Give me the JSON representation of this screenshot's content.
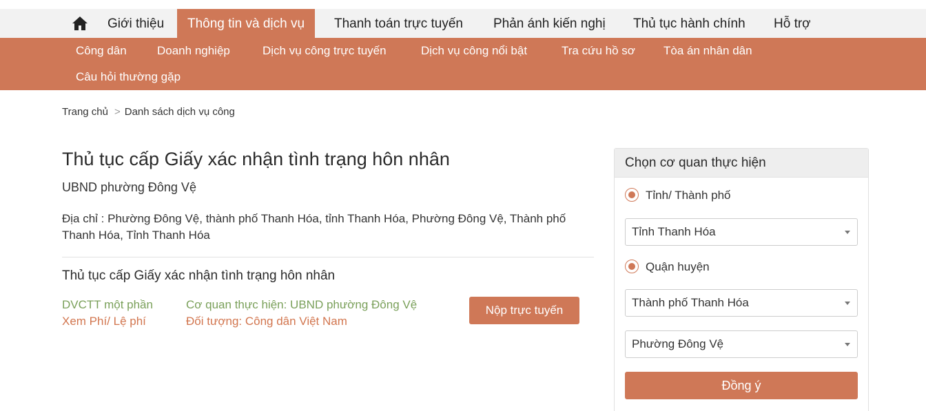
{
  "topnav": {
    "items": [
      {
        "label": "Giới thiệu"
      },
      {
        "label": "Thông tin và dịch vụ"
      },
      {
        "label": "Thanh toán trực tuyến"
      },
      {
        "label": "Phản ánh kiến nghị"
      },
      {
        "label": "Thủ tục hành chính"
      },
      {
        "label": "Hỗ trợ"
      }
    ],
    "home_icon": "home-icon"
  },
  "subnav": {
    "items": [
      {
        "label": "Công dân"
      },
      {
        "label": "Doanh nghiệp"
      },
      {
        "label": "Dịch vụ công trực tuyến"
      },
      {
        "label": "Dịch vụ công nổi bật"
      },
      {
        "label": "Tra cứu hồ sơ"
      },
      {
        "label": "Tòa án nhân dân"
      },
      {
        "label": "Câu hỏi thường gặp"
      }
    ]
  },
  "breadcrumb": {
    "home": "Trang chủ",
    "separator": ">",
    "current": "Danh sách dịch vụ công"
  },
  "main": {
    "title": "Thủ tục cấp Giấy xác nhận tình trạng hôn nhân",
    "agency": "UBND phường Đông Vệ",
    "address": "Địa chỉ : Phường Đông Vệ, thành phố Thanh Hóa, tỉnh Thanh Hóa, Phường Đông Vệ, Thành phố Thanh Hóa, Tỉnh Thanh Hóa",
    "procedure": {
      "title": "Thủ tục cấp Giấy xác nhận tình trạng hôn nhân",
      "level": "DVCTT một phần",
      "fee_link": "Xem Phí/ Lệ phí",
      "agency": "Cơ quan thực hiện: UBND phường Đông Vệ",
      "target": "Đối tượng: Công dân Việt Nam",
      "submit_label": "Nộp trực tuyến"
    }
  },
  "sidebar": {
    "title": "Chọn cơ quan thực hiện",
    "radio_province": "Tỉnh/ Thành phố",
    "province_value": "Tỉnh Thanh Hóa",
    "radio_district": "Quận huyện",
    "district_value": "Thành phố Thanh Hóa",
    "ward_value": "Phường Đông Vệ",
    "agree_label": "Đồng ý"
  },
  "colors": {
    "accent": "#cf7857",
    "green_text": "#7aa05a",
    "orange_text": "#d2764f",
    "nav_bg": "#f2f2f2"
  }
}
